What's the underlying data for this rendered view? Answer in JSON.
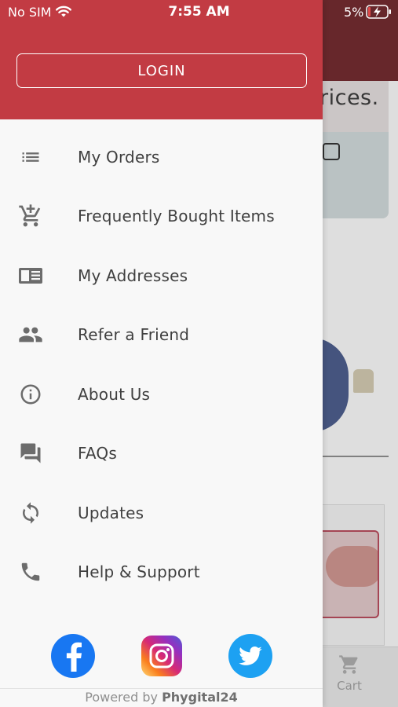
{
  "status_bar": {
    "carrier": "No SIM",
    "time": "7:55 AM",
    "battery": "5%"
  },
  "drawer": {
    "login_label": "LOGIN",
    "menu_items": [
      {
        "label": "My Orders",
        "icon": "list-icon"
      },
      {
        "label": "Frequently Bought Items",
        "icon": "cart-add-icon"
      },
      {
        "label": "My Addresses",
        "icon": "address-card-icon"
      },
      {
        "label": "Refer a Friend",
        "icon": "people-icon"
      },
      {
        "label": "About Us",
        "icon": "info-icon"
      },
      {
        "label": "FAQs",
        "icon": "chat-icon"
      },
      {
        "label": "Updates",
        "icon": "sync-icon"
      },
      {
        "label": "Help & Support",
        "icon": "phone-icon"
      }
    ],
    "social": [
      "facebook",
      "instagram",
      "twitter"
    ],
    "footer": {
      "prefix": "Powered by",
      "brand": "Phygital24"
    }
  },
  "background_app": {
    "banner_text": "rices.",
    "tab_cart_label": "Cart"
  },
  "colors": {
    "drawer_header": "#c23b43",
    "app_header": "#6e2a2e",
    "menu_text": "#3f3f3f"
  }
}
